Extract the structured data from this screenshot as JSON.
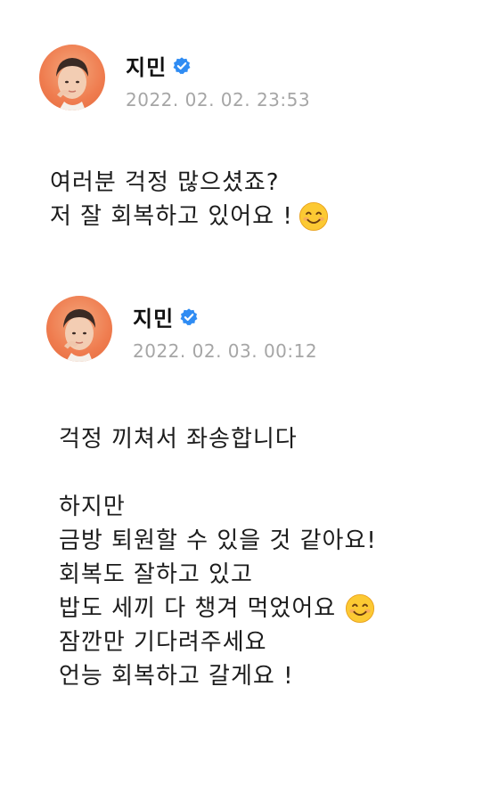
{
  "posts": [
    {
      "author": "지민",
      "verified_icon": "verified-badge-icon",
      "avatar_icon": "profile-avatar",
      "timestamp": "2022. 02. 02. 23:53",
      "lines": [
        {
          "text": "여러분 걱정 많으셨죠?",
          "emoji": ""
        },
        {
          "text": "저 잘 회복하고 있어요 !",
          "emoji": "smiling-face-icon"
        }
      ]
    },
    {
      "author": "지민",
      "verified_icon": "verified-badge-icon",
      "avatar_icon": "profile-avatar",
      "timestamp": "2022. 02. 03. 00:12",
      "lines": [
        {
          "text": "걱정 끼쳐서 좌송합니다",
          "emoji": ""
        },
        {
          "text": "",
          "emoji": ""
        },
        {
          "text": "하지만",
          "emoji": ""
        },
        {
          "text": "금방 퇴원할 수 있을 것 같아요!",
          "emoji": ""
        },
        {
          "text": "회복도 잘하고 있고",
          "emoji": ""
        },
        {
          "text": "밥도 세끼 다 챙겨 먹었어요",
          "emoji": "smiling-face-icon"
        },
        {
          "text": "잠깐만 기다려주세요",
          "emoji": ""
        },
        {
          "text": "언능 회복하고 갈게요 !",
          "emoji": ""
        }
      ]
    }
  ],
  "colors": {
    "background": "#ffffff",
    "text": "#1c1c1c",
    "timestamp": "#a6a6a6",
    "verified": "#2f8cf3",
    "avatar_bg": "#ef7c4f"
  }
}
